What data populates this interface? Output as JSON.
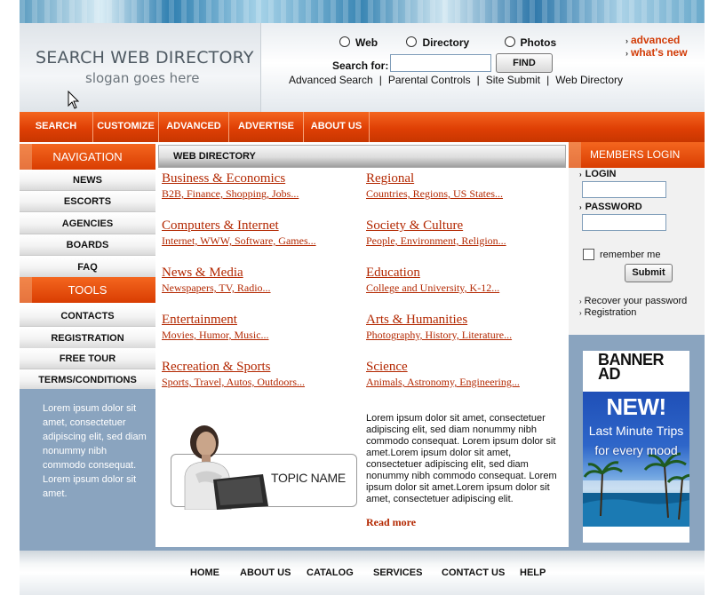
{
  "header": {
    "site_title": "SEARCH WEB DIRECTORY",
    "slogan": "slogan goes here"
  },
  "search": {
    "options": [
      "Web",
      "Directory",
      "Photos"
    ],
    "label": "Search for:",
    "placeholder": "",
    "value": "",
    "button": "FIND",
    "links": [
      "Advanced Search",
      "Parental Controls",
      "Site Submit",
      "Web Directory"
    ],
    "separator": "|"
  },
  "quick_links": [
    "advanced",
    "what's new"
  ],
  "top_nav": [
    "SEARCH",
    "CUSTOMIZE",
    "ADVANCED",
    "ADVERTISE",
    "ABOUT US"
  ],
  "left_nav": {
    "navigation_title": "NAVIGATION",
    "navigation_items": [
      "NEWS",
      "ESCORTS",
      "AGENCIES",
      "BOARDS",
      "FAQ"
    ],
    "tools_title": "TOOLS",
    "tools_items": [
      "CONTACTS",
      "REGISTRATION",
      "FREE TOUR",
      "TERMS/CONDITIONS"
    ],
    "blurb": "Lorem ipsum dolor sit amet, consectetuer adipiscing elit, sed diam nonummy nibh commodo consequat. Lorem ipsum dolor sit amet."
  },
  "main": {
    "heading": "WEB DIRECTORY",
    "categories": [
      {
        "title": "Business & Economics",
        "sub": "B2B, Finance, Shopping, Jobs..."
      },
      {
        "title": "Regional",
        "sub": "Countries, Regions, US States..."
      },
      {
        "title": "Computers & Internet",
        "sub": "Internet, WWW, Software, Games..."
      },
      {
        "title": "Society & Culture",
        "sub": "People, Environment, Religion..."
      },
      {
        "title": "News & Media",
        "sub": "Newspapers, TV, Radio..."
      },
      {
        "title": "Education",
        "sub": "College and University, K-12..."
      },
      {
        "title": "Entertainment",
        "sub": "Movies, Humor, Music..."
      },
      {
        "title": "Arts & Humanities",
        "sub": "Photography, History, Literature..."
      },
      {
        "title": "Recreation & Sports",
        "sub": "Sports, Travel, Autos, Outdoors..."
      },
      {
        "title": "Science",
        "sub": "Animals, Astronomy, Engineering..."
      }
    ],
    "topic_name": "TOPIC NAME",
    "paragraph": "Lorem ipsum dolor sit amet, consectetuer adipiscing elit, sed diam nonummy nibh commodo consequat. Lorem ipsum dolor sit amet.Lorem ipsum dolor sit amet, consectetuer adipiscing elit, sed diam nonummy nibh commodo consequat. Lorem ipsum dolor sit amet.Lorem ipsum dolor sit amet, consectetuer adipiscing elit.",
    "read_more": "Read more"
  },
  "login": {
    "title": "MEMBERS LOGIN",
    "login_label": "LOGIN",
    "password_label": "PASSWORD",
    "remember": "remember me",
    "submit": "Submit",
    "links": [
      "Recover your password",
      "Registration"
    ]
  },
  "banner": {
    "label_line1": "BANNER",
    "label_line2": "AD",
    "headline": "NEW!",
    "line1": "Last Minute Trips",
    "line2": "for every mood"
  },
  "footer_nav": [
    "HOME",
    "ABOUT US",
    "CATALOG",
    "SERVICES",
    "CONTACT US",
    "HELP"
  ],
  "colors": {
    "accent_orange": "#df3f05",
    "link_red": "#b32700",
    "panel_blue": "#8aa4bf"
  }
}
